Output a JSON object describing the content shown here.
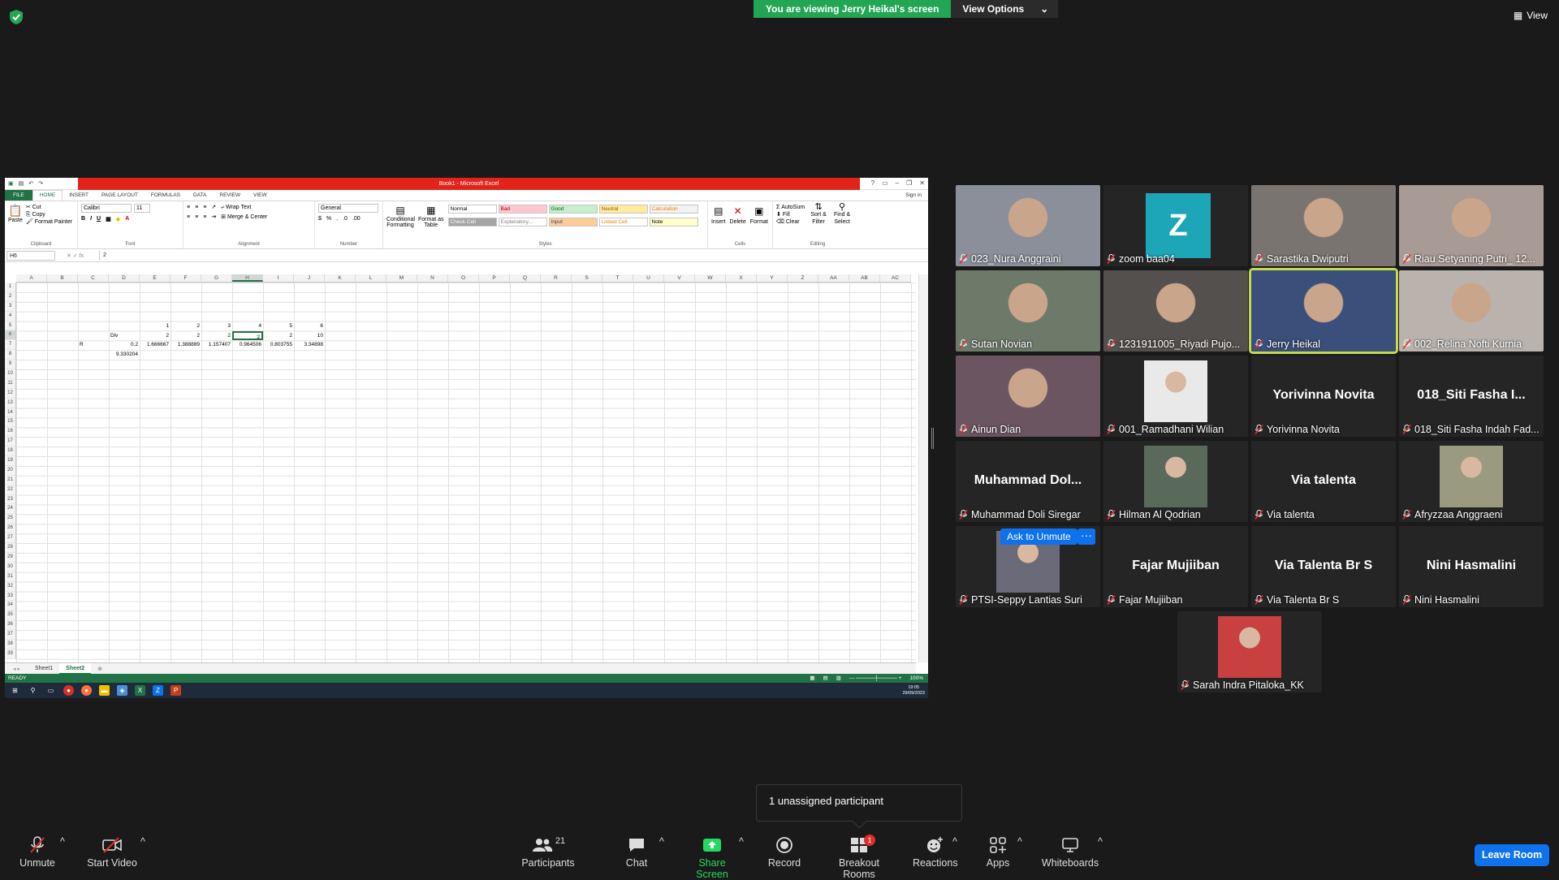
{
  "banner": {
    "viewing_text": "You are viewing Jerry Heikal's screen",
    "view_options": "View Options",
    "view": "View"
  },
  "excel": {
    "window_title": "Book1 - Microsoft Excel",
    "tabs": [
      "FILE",
      "HOME",
      "INSERT",
      "PAGE LAYOUT",
      "FORMULAS",
      "DATA",
      "REVIEW",
      "VIEW"
    ],
    "sign_in": "Sign in",
    "clipboard": {
      "paste": "Paste",
      "cut": "Cut",
      "copy": "Copy",
      "format_painter": "Format Painter",
      "label": "Clipboard"
    },
    "font": {
      "name": "Calibri",
      "size": "11",
      "label": "Font"
    },
    "alignment": {
      "wrap": "Wrap Text",
      "merge": "Merge & Center",
      "label": "Alignment"
    },
    "number": {
      "format": "General",
      "label": "Number"
    },
    "styles_group": {
      "conditional": "Conditional Formatting",
      "format_table": "Format as Table",
      "label": "Styles",
      "items": [
        {
          "t": "Normal",
          "bg": "#ffffff",
          "fg": "#000000"
        },
        {
          "t": "Bad",
          "bg": "#ffc7ce",
          "fg": "#9c0006"
        },
        {
          "t": "Good",
          "bg": "#c6efce",
          "fg": "#006100"
        },
        {
          "t": "Neutral",
          "bg": "#ffeb9c",
          "fg": "#9c5700"
        },
        {
          "t": "Calculation",
          "bg": "#f2f2f2",
          "fg": "#fa7d00"
        },
        {
          "t": "Check Cell",
          "bg": "#a5a5a5",
          "fg": "#ffffff"
        },
        {
          "t": "Explanatory...",
          "bg": "#ffffff",
          "fg": "#7f7f7f"
        },
        {
          "t": "Input",
          "bg": "#ffcc99",
          "fg": "#3f3f76"
        },
        {
          "t": "Linked Cell",
          "bg": "#ffffff",
          "fg": "#fa7d00"
        },
        {
          "t": "Note",
          "bg": "#ffffcc",
          "fg": "#000000"
        }
      ]
    },
    "cells_group": {
      "insert": "Insert",
      "delete": "Delete",
      "format": "Format",
      "label": "Cells"
    },
    "editing": {
      "autosum": "AutoSum",
      "fill": "Fill",
      "clear": "Clear",
      "sort": "Sort & Filter",
      "find": "Find & Select",
      "label": "Editing"
    },
    "name_box": "H6",
    "formula": "2",
    "columns": [
      "A",
      "B",
      "C",
      "D",
      "E",
      "F",
      "G",
      "H",
      "I",
      "J",
      "K",
      "L",
      "M",
      "N",
      "O",
      "P",
      "Q",
      "R",
      "S",
      "T",
      "U",
      "V",
      "W",
      "X",
      "Y",
      "Z",
      "AA",
      "AB",
      "AC"
    ],
    "rows": 39,
    "sheets": [
      "Sheet1",
      "Sheet2"
    ],
    "status": "READY",
    "zoom": "100%",
    "clock_time": "19:05",
    "clock_date": "29/09/2023"
  },
  "cells": [
    {
      "id": "E5",
      "v": "1"
    },
    {
      "id": "F5",
      "v": "2"
    },
    {
      "id": "G5",
      "v": "3"
    },
    {
      "id": "H5",
      "v": "4"
    },
    {
      "id": "I5",
      "v": "5"
    },
    {
      "id": "J5",
      "v": "6"
    },
    {
      "id": "D6",
      "v": "Div",
      "align": "l"
    },
    {
      "id": "E6",
      "v": "2"
    },
    {
      "id": "F6",
      "v": "2"
    },
    {
      "id": "G6",
      "v": "2"
    },
    {
      "id": "H6",
      "v": "2"
    },
    {
      "id": "I6",
      "v": "2"
    },
    {
      "id": "J6",
      "v": "10"
    },
    {
      "id": "C7",
      "v": "R",
      "align": "l"
    },
    {
      "id": "D7",
      "v": "0.2"
    },
    {
      "id": "E7",
      "v": "1.666667"
    },
    {
      "id": "F7",
      "v": "1.388889"
    },
    {
      "id": "G7",
      "v": "1.157407"
    },
    {
      "id": "H7",
      "v": "0.964506"
    },
    {
      "id": "I7",
      "v": "0.803755"
    },
    {
      "id": "J7",
      "v": "3.34898"
    },
    {
      "id": "D8",
      "v": "9.330204"
    }
  ],
  "participants": [
    {
      "name": "023_Nura Anggraini",
      "kind": "video",
      "bg": "#8a8f99"
    },
    {
      "name": "zoom baa04",
      "kind": "avatar",
      "initial": "Z"
    },
    {
      "name": "Sarastika Dwiputri",
      "kind": "video",
      "bg": "#7a7470"
    },
    {
      "name": "Riau Setyaning Putri_ 12...",
      "kind": "video",
      "bg": "#a89a94"
    },
    {
      "name": "Sutan Novian",
      "kind": "video",
      "bg": "#6d7a6a"
    },
    {
      "name": "1231911005_Riyadi Pujo...",
      "kind": "video",
      "bg": "#54504e"
    },
    {
      "name": "Jerry Heikal",
      "kind": "video",
      "bg": "#3a4f7a",
      "speaking": true
    },
    {
      "name": "002_Relina Nofti Kurnia",
      "kind": "video",
      "bg": "#b9b2ad"
    },
    {
      "name": "Ainun Dian",
      "kind": "video",
      "bg": "#6b5560"
    },
    {
      "name": "001_Ramadhani Wilian",
      "kind": "photo",
      "bg": "#e9e9e9"
    },
    {
      "name": "Yorivinna Novita",
      "kind": "name",
      "big": "Yorivinna Novita"
    },
    {
      "name": "018_Siti Fasha Indah Fad...",
      "kind": "name",
      "big": "018_Siti Fasha I..."
    },
    {
      "name": "Muhammad Doli Siregar",
      "kind": "name",
      "big": "Muhammad  Dol..."
    },
    {
      "name": "Hilman Al Qodrian",
      "kind": "photo",
      "bg": "#5a6a5a"
    },
    {
      "name": "Via talenta",
      "kind": "name",
      "big": "Via talenta"
    },
    {
      "name": "Afryzzaa Anggraeni",
      "kind": "photo",
      "bg": "#9a9a80"
    },
    {
      "name": "PTSI-Seppy Lantias Suri",
      "kind": "photo",
      "bg": "#6a6a78"
    },
    {
      "name": "Fajar Mujiiban",
      "kind": "name",
      "big": "Fajar Mujiiban"
    },
    {
      "name": "Via Talenta Br S",
      "kind": "name",
      "big": "Via Talenta Br S"
    },
    {
      "name": "Nini Hasmalini",
      "kind": "name",
      "big": "Nini Hasmalini"
    },
    {
      "name": "Sarah Indra Pitaloka_KK",
      "kind": "photo",
      "bg": "#c84040"
    }
  ],
  "ask_unmute": "Ask to Unmute",
  "tooltip": "1 unassigned participant",
  "toolbar": {
    "unmute": "Unmute",
    "start_video": "Start Video",
    "participants": "Participants",
    "participants_count": "21",
    "chat": "Chat",
    "share": "Share Screen",
    "record": "Record",
    "breakout": "Breakout Rooms",
    "breakout_badge": "1",
    "reactions": "Reactions",
    "apps": "Apps",
    "whiteboards": "Whiteboards",
    "leave": "Leave Room"
  },
  "colors": {
    "zoom_blue": "#0e72ed",
    "green": "#23a654",
    "excel_green": "#217346"
  }
}
